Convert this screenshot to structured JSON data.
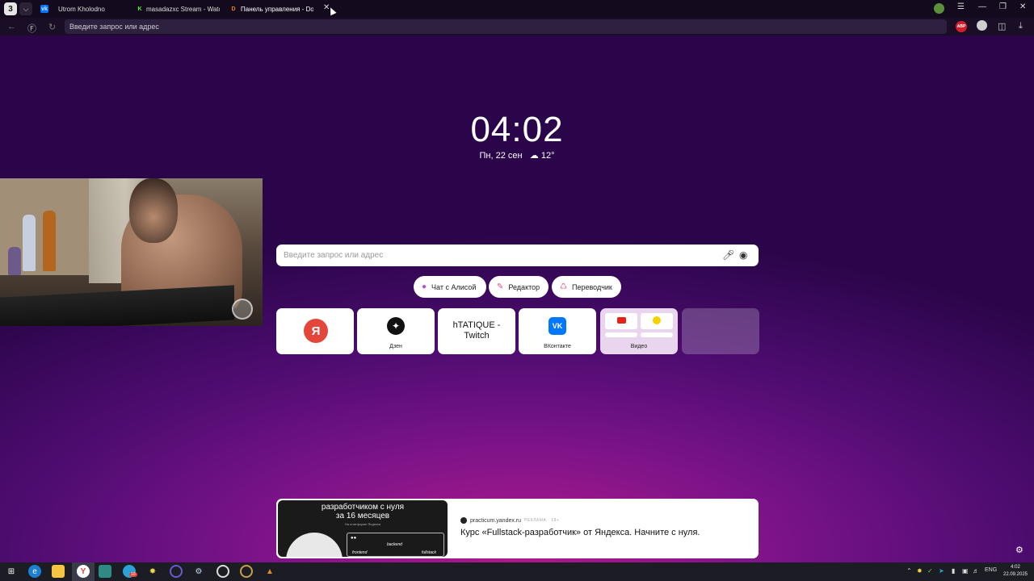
{
  "browser": {
    "tab_count": "3",
    "tabs": [
      {
        "title": "Utrom Kholodno",
        "favicon": "vk-icon",
        "color": "#0077ff"
      },
      {
        "title": "masadazxc Stream - Watc",
        "favicon": "kick-icon",
        "color": "#53fc18"
      },
      {
        "title": "Панель управления - Dor",
        "favicon": "donationalerts-icon",
        "color": "#f57d07"
      }
    ],
    "address_placeholder": "Введите запрос или адрес",
    "extension_abp": "ABP"
  },
  "newtab": {
    "clock": "04:02",
    "date": "Пн, 22 сен",
    "weather": "12°",
    "search_placeholder": "Введите запрос или адрес",
    "chips": [
      {
        "label": "Чат с Алисой",
        "icon": "alice-icon"
      },
      {
        "label": "Редактор",
        "icon": "editor-icon"
      },
      {
        "label": "Переводчик",
        "icon": "translate-icon"
      }
    ],
    "tiles": {
      "yandex_glyph": "Я",
      "dzen_label": "Дзен",
      "twitch_line1": "hTATIQUE -",
      "twitch_line2": "Twitch",
      "vk_glyph": "VK",
      "vk_label": "ВКонтакте",
      "video_label": "Видео"
    },
    "ad": {
      "image_title_1": "разработчиком с нуля",
      "image_title_2": "за 16 месяцев",
      "image_sub": "На платформе Яндекса",
      "labels": [
        "backend",
        "frontend",
        "fullstack"
      ],
      "domain": "practicum.yandex.ru",
      "tag": "РЕКЛАМА · 18+",
      "text": "Курс «Fullstack-разработчик» от Яндекса. Начните с нуля."
    }
  },
  "taskbar": {
    "badge_count": "10",
    "lang": "ENG",
    "time": "4:02",
    "date": "22.09.2025"
  }
}
